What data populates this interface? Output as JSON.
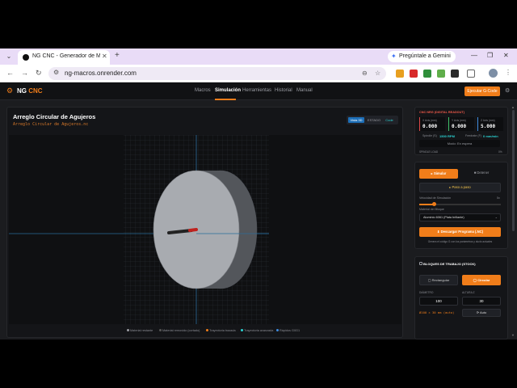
{
  "browser": {
    "tab_title": "NG CNC - Generador de Macros",
    "new_tab": "+",
    "gemini_label": "Pregúntale a Gemini",
    "url": "ng-macros.onrender.com"
  },
  "app": {
    "logo_main": "NG",
    "logo_accent": "CNC",
    "nav": [
      "Macros",
      "Simulación",
      "Herramientas",
      "Historial",
      "Manual"
    ],
    "active_nav": "Simulación",
    "gcode_button": "Ejecutar G-Code"
  },
  "main": {
    "title": "Arreglo Circular de Agujeros",
    "file": "Arreglo Circular de Agujeros.nc",
    "view_3d": "Vista 3D",
    "view_estado": "ESTADO",
    "view_code": "Code",
    "legend": [
      "Material restante",
      "Material removido (cortado)",
      "Trayectoria trazada",
      "Trayectoria avanzada",
      "Rápidos G0G1"
    ]
  },
  "dro": {
    "title": "CNC NRG (DIGITAL READOUT)",
    "axes": [
      {
        "label": "X Axis (mm)",
        "value": "0.000",
        "color": "#e04848"
      },
      {
        "label": "Y Axis (mm)",
        "value": "0.000",
        "color": "#3fc36a"
      },
      {
        "label": "Z Axis (mm)",
        "value": "5.000",
        "color": "#3f8ce0"
      }
    ],
    "spindle_label": "Spindle (S)",
    "spindle_value": "1500 RPM",
    "feedrate_label": "Feedrate (F)",
    "feedrate_value": "0 mm/min",
    "modo_label": "Modo:",
    "modo_value": "En espera",
    "spindle_load": "SPINDLE LOAD",
    "spindle_pct": "0%"
  },
  "controls": {
    "simular": "Simular",
    "detener": "Detener",
    "paso": "Paso a paso",
    "velocidad_label": "Velocidad de Simulación",
    "velocidad_value": "5x",
    "velocidad_fraction": 0.18,
    "material_label": "Material del Bloque",
    "material_value": "Aluminio 6061 (Plata brillante)",
    "download": "Descargar Programa (.NC)",
    "note": "Genera el código G con los parámetros y ducto actuales"
  },
  "stock": {
    "title": "BLOQUES DE TRABAJO (STOCK)",
    "rect_btn": "Rectangular",
    "circ_btn": "Circular",
    "diam_label": "DIÁMETRO",
    "diam_value": "100",
    "height_label": "ALTURA Z",
    "height_value": "30",
    "info": "Ø100 × 30 mm (auto)",
    "auto_btn": "Auto"
  }
}
